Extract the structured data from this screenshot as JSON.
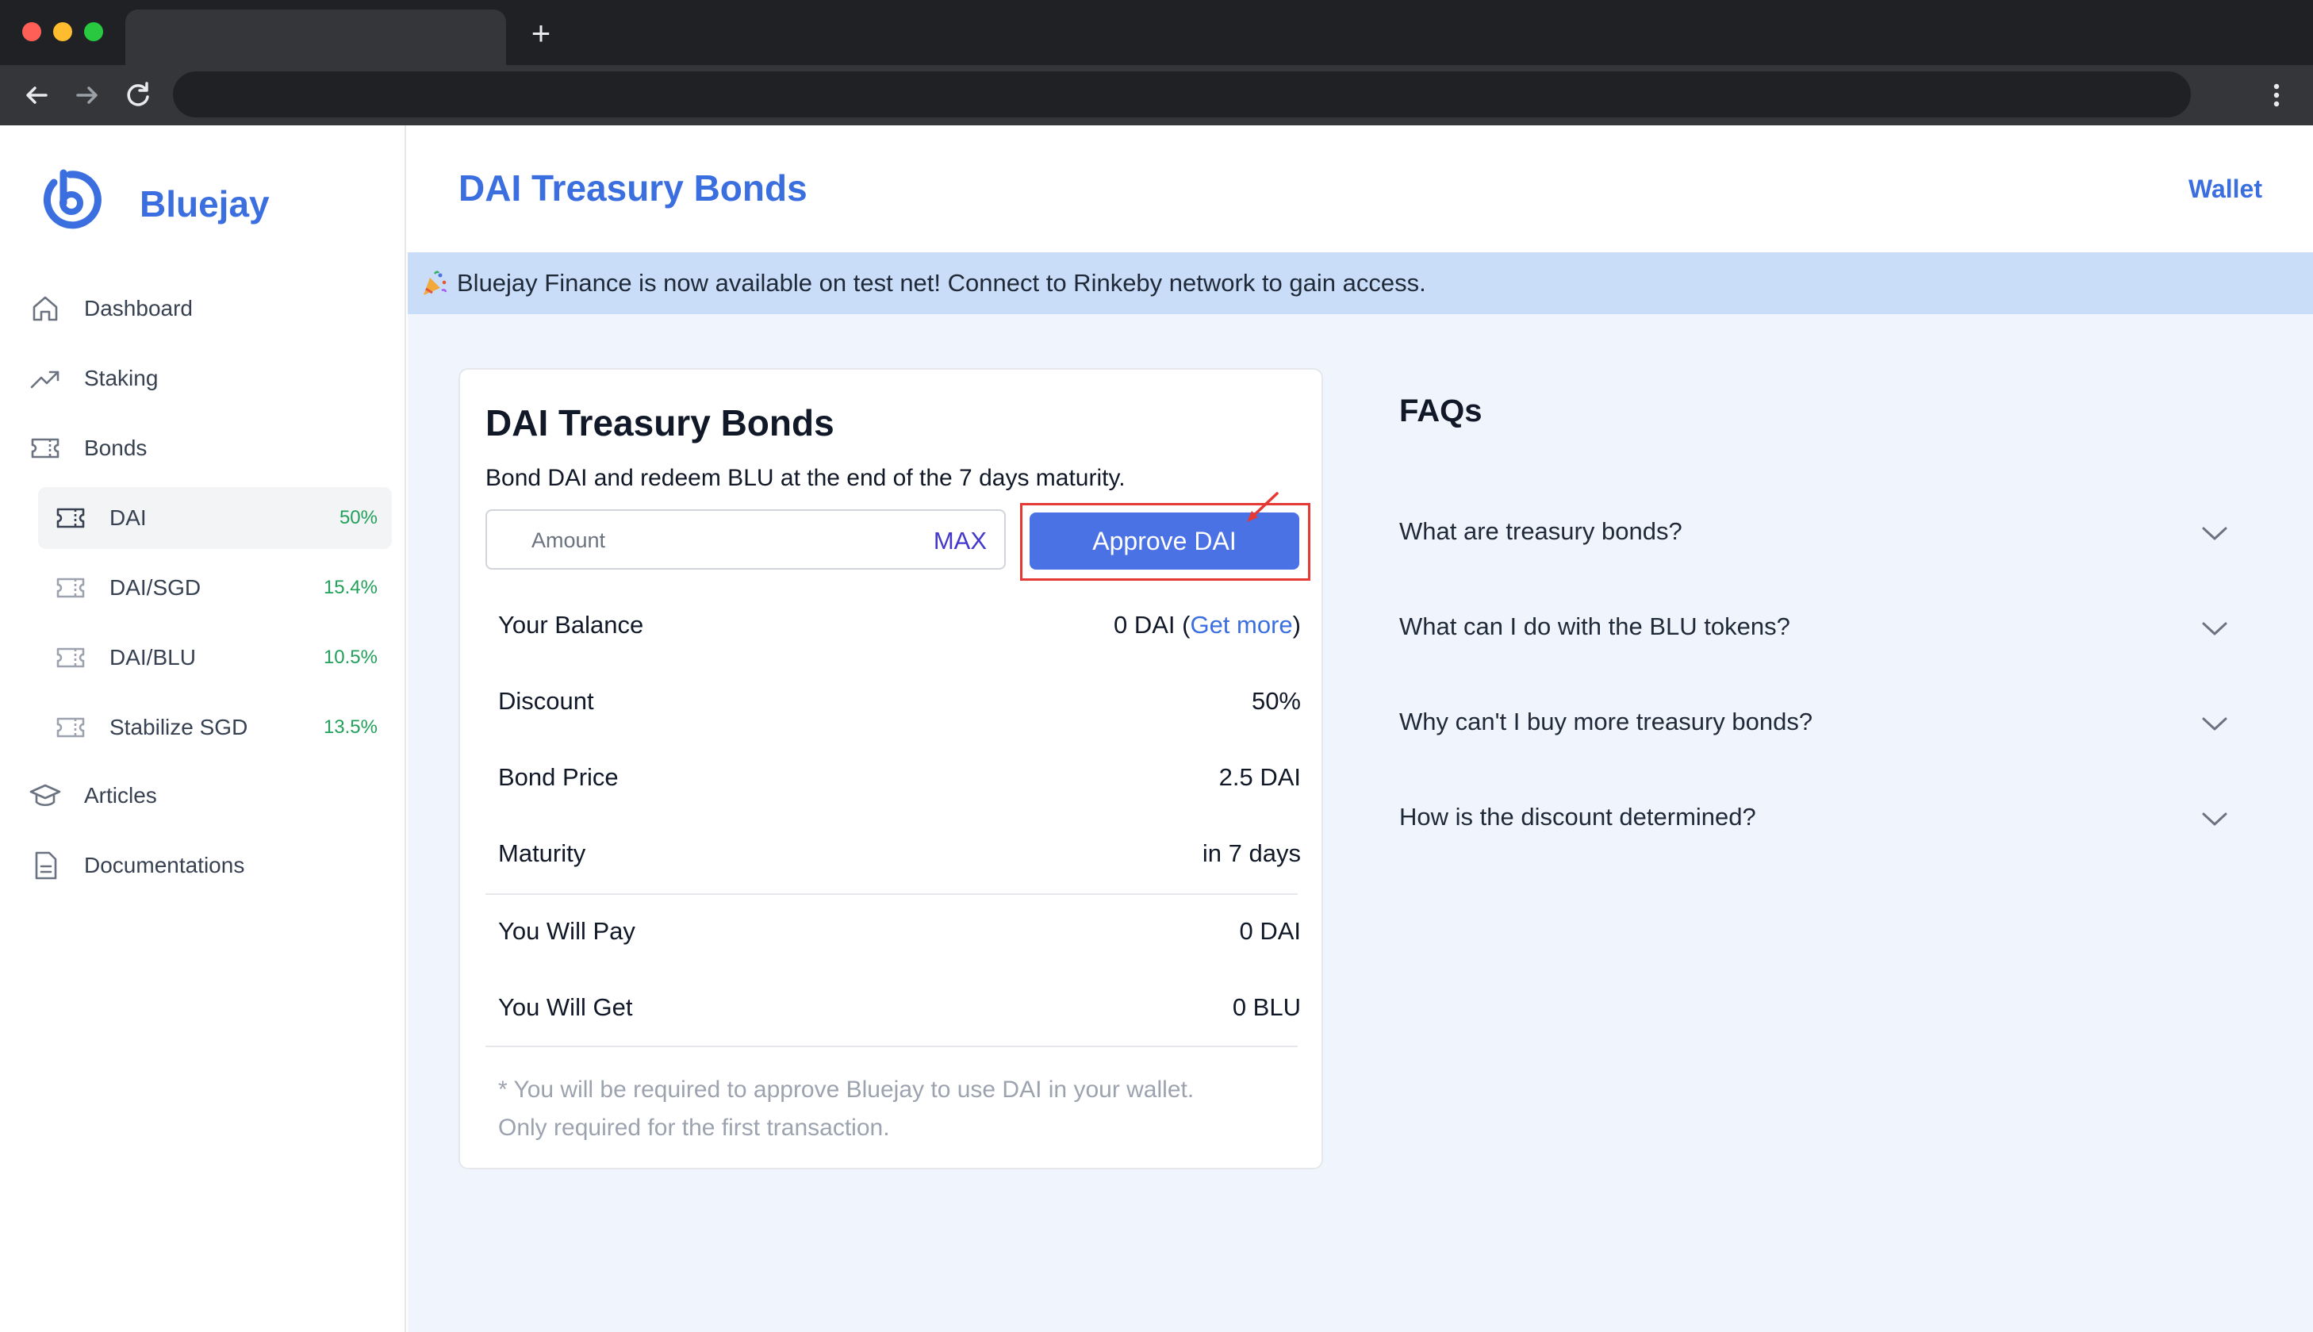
{
  "app": {
    "name": "Bluejay",
    "page_title": "DAI Treasury Bonds",
    "wallet_label": "Wallet",
    "banner_text": "Bluejay Finance is now available on test net! Connect to Rinkeby network to gain access."
  },
  "sidebar": {
    "items": [
      {
        "label": "Dashboard",
        "icon": "home-icon"
      },
      {
        "label": "Staking",
        "icon": "trending-up-icon"
      },
      {
        "label": "Bonds",
        "icon": "ticket-icon"
      },
      {
        "label": "Articles",
        "icon": "graduation-cap-icon"
      },
      {
        "label": "Documentations",
        "icon": "document-icon"
      }
    ],
    "bonds": [
      {
        "label": "DAI",
        "pct": "50%",
        "active": true
      },
      {
        "label": "DAI/SGD",
        "pct": "15.4%"
      },
      {
        "label": "DAI/BLU",
        "pct": "10.5%"
      },
      {
        "label": "Stabilize SGD",
        "pct": "13.5%"
      }
    ]
  },
  "card": {
    "title": "DAI Treasury Bonds",
    "subtitle": "Bond DAI and redeem BLU at the end of the 7 days maturity.",
    "amount_placeholder": "Amount",
    "max_label": "MAX",
    "approve_label": "Approve DAI",
    "rows": [
      {
        "label": "Your Balance",
        "value_prefix": "0 DAI (",
        "link": "Get more",
        "value_suffix": ")"
      },
      {
        "label": "Discount",
        "value": "50%"
      },
      {
        "label": "Bond Price",
        "value": "2.5 DAI"
      },
      {
        "label": "Maturity",
        "value": "in 7 days"
      },
      {
        "label": "You Will Pay",
        "value": "0 DAI"
      },
      {
        "label": "You Will Get",
        "value": "0 BLU"
      }
    ],
    "note_line1": "* You will be required to approve Bluejay to use DAI in your wallet.",
    "note_line2": "Only required for the first transaction."
  },
  "faq": {
    "title": "FAQs",
    "items": [
      "What are treasury bonds?",
      "What can I do with the BLU tokens?",
      "Why can't I buy more treasury bonds?",
      "How is the discount determined?"
    ]
  },
  "colors": {
    "brand": "#3b6fe0",
    "button": "#4b72e5",
    "banner": "#c9dcf8",
    "positive": "#22a05a",
    "highlight": "#e53935"
  }
}
